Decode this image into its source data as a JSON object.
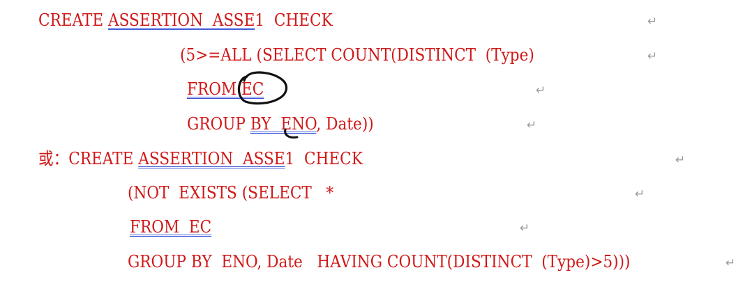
{
  "lines": [
    {
      "seg": [
        "CREATE ",
        "ASSERTION  ASSE",
        "1  CHECK"
      ]
    },
    {
      "seg": [
        "(5>=ALL (SELECT COUNT(DISTINCT  (Type)"
      ]
    },
    {
      "seg": [
        "FROM ",
        "EC"
      ]
    },
    {
      "seg": [
        "GROUP ",
        "BY  ENO",
        ", Date))"
      ]
    },
    {
      "seg": [
        "或：CREATE ",
        "ASSERTION  ASSE",
        "1  CHECK"
      ]
    },
    {
      "seg": [
        "(NOT  EXISTS (SELECT   *"
      ]
    },
    {
      "seg": [
        "FROM  EC"
      ]
    },
    {
      "seg": [
        "GROUP BY  ENO, Date   HAVING COUNT(DISTINCT  (Type)>5)))"
      ]
    }
  ],
  "paragraph_mark": "↵",
  "colors": {
    "text": "#d01818",
    "underline": "#3b55d6",
    "ink": "#111111"
  }
}
